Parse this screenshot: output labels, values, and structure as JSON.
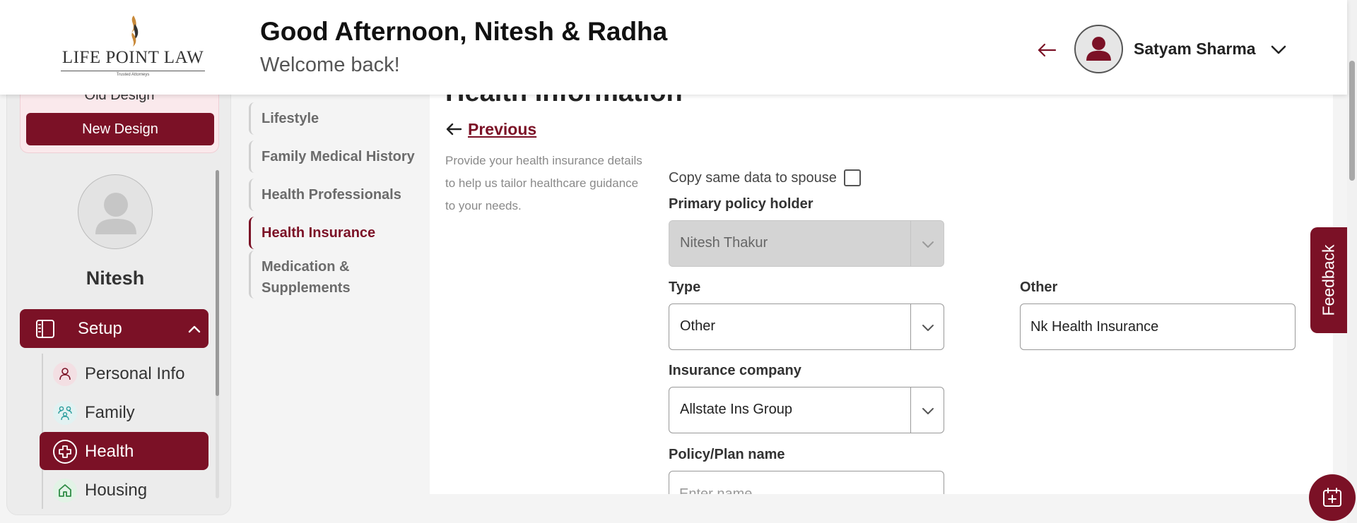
{
  "brand": {
    "name": "LIFE POINT LAW",
    "tagline": "Trusted Attorneys",
    "color": "#7b1126"
  },
  "header": {
    "greeting": "Good Afternoon, Nitesh & Radha",
    "welcome": "Welcome back!",
    "user_name": "Satyam Sharma",
    "icons": {
      "back": "arrow-left-icon",
      "avatar": "user-avatar-icon",
      "menu": "chevron-down-icon"
    }
  },
  "sidebar": {
    "old_design": "Old Design",
    "new_design": "New Design",
    "profile_name": "Nitesh",
    "setup_label": "Setup",
    "items": [
      {
        "label": "Personal Info",
        "icon": "person-icon"
      },
      {
        "label": "Family",
        "icon": "family-icon"
      },
      {
        "label": "Health",
        "icon": "health-cross-icon",
        "active": true
      },
      {
        "label": "Housing",
        "icon": "home-icon"
      }
    ]
  },
  "steps": [
    {
      "label": "Lifestyle"
    },
    {
      "label": "Family Medical History"
    },
    {
      "label": "Health Professionals"
    },
    {
      "label": "Health Insurance",
      "active": true
    },
    {
      "label": "Medication & Supplements"
    }
  ],
  "main": {
    "section_title": "Health Information",
    "previous": "Previous",
    "description": "Provide your health insurance details to help us tailor healthcare guidance to your needs.",
    "copy_label": "Copy same data to spouse",
    "copy_checked": false,
    "primary_label": "Primary policy holder",
    "primary_value": "Nitesh Thakur",
    "type_label": "Type",
    "type_value": "Other",
    "other_label": "Other",
    "other_value": "Nk Health Insurance",
    "company_label": "Insurance company",
    "company_value": "Allstate Ins Group",
    "plan_label": "Policy/Plan name",
    "plan_placeholder": "Enter name"
  },
  "feedback": "Feedback",
  "fab_icon": "calendar-plus-icon"
}
